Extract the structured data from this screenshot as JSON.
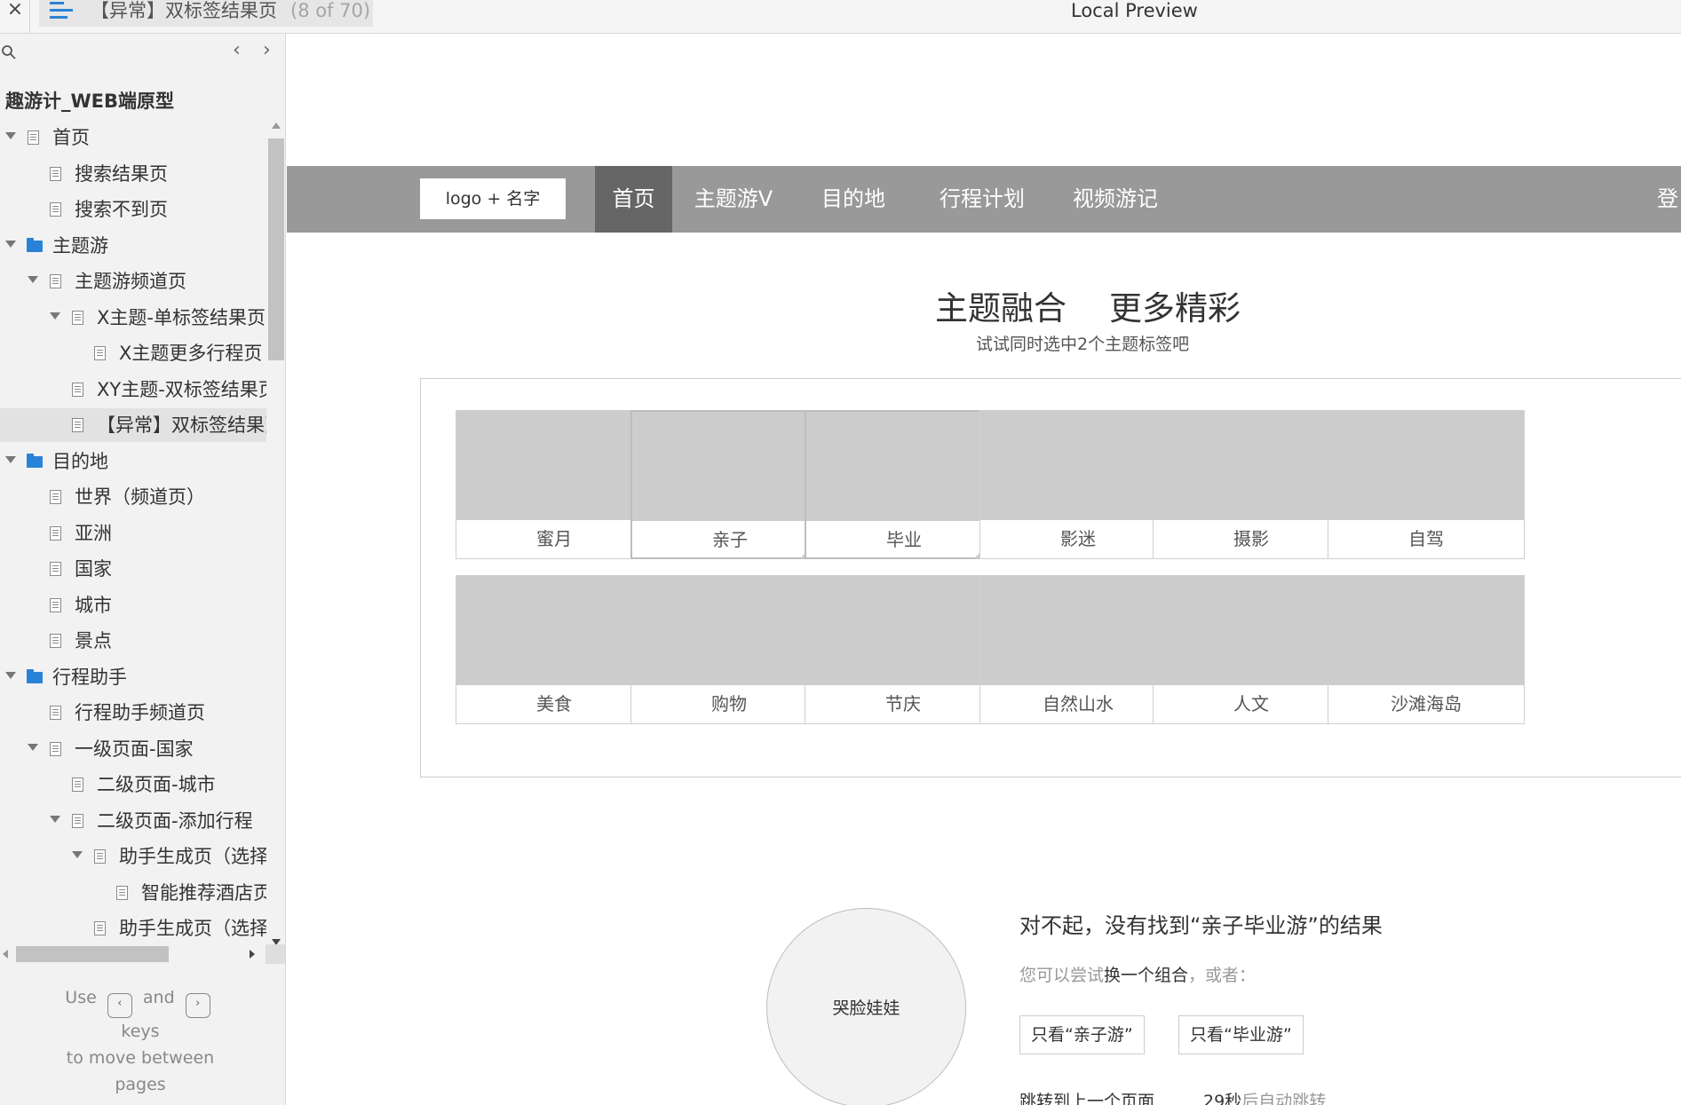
{
  "topbar": {
    "close_glyph": "×",
    "menu_icon": "hamburger-menu-icon",
    "tab_title": "【异常】双标签结果页",
    "tab_count": "(8 of 70)",
    "preview_title": "Local Preview"
  },
  "sidebar": {
    "search_icon": "search-icon",
    "prev_glyph": "‹",
    "next_glyph": "›",
    "project_name": "趣游计_WEB端原型",
    "tree": [
      {
        "label": "首页",
        "type": "page",
        "level": 0,
        "toggle": true
      },
      {
        "label": "搜索结果页",
        "type": "page",
        "level": 1,
        "toggle": false
      },
      {
        "label": "搜索不到页",
        "type": "page",
        "level": 1,
        "toggle": false
      },
      {
        "label": "主题游",
        "type": "folder",
        "level": 0,
        "toggle": true
      },
      {
        "label": "主题游频道页",
        "type": "page",
        "level": 1,
        "toggle": true
      },
      {
        "label": "X主题-单标签结果页",
        "type": "page",
        "level": 2,
        "toggle": true
      },
      {
        "label": "X主题更多行程页",
        "type": "page",
        "level": 3,
        "toggle": false
      },
      {
        "label": "XY主题-双标签结果页",
        "type": "page",
        "level": 2,
        "toggle": false
      },
      {
        "label": "【异常】双标签结果页",
        "type": "page",
        "level": 2,
        "toggle": false,
        "selected": true
      },
      {
        "label": "目的地",
        "type": "folder",
        "level": 0,
        "toggle": true
      },
      {
        "label": "世界（频道页）",
        "type": "page",
        "level": 1,
        "toggle": false
      },
      {
        "label": "亚洲",
        "type": "page",
        "level": 1,
        "toggle": false
      },
      {
        "label": "国家",
        "type": "page",
        "level": 1,
        "toggle": false
      },
      {
        "label": "城市",
        "type": "page",
        "level": 1,
        "toggle": false
      },
      {
        "label": "景点",
        "type": "page",
        "level": 1,
        "toggle": false
      },
      {
        "label": "行程助手",
        "type": "folder",
        "level": 0,
        "toggle": true
      },
      {
        "label": "行程助手频道页",
        "type": "page",
        "level": 1,
        "toggle": false
      },
      {
        "label": "一级页面-国家",
        "type": "page",
        "level": 1,
        "toggle": true
      },
      {
        "label": "二级页面-城市",
        "type": "page",
        "level": 2,
        "toggle": false
      },
      {
        "label": "二级页面-添加行程",
        "type": "page",
        "level": 2,
        "toggle": true
      },
      {
        "label": "助手生成页（选择",
        "type": "page",
        "level": 3,
        "toggle": true
      },
      {
        "label": "智能推荐酒店页",
        "type": "page",
        "level": 4,
        "toggle": false
      },
      {
        "label": "助手生成页（选择",
        "type": "page",
        "level": 3,
        "toggle": false
      }
    ],
    "hint": {
      "use": "Use",
      "key_prev": "‹",
      "and": "and",
      "key_next": "›",
      "keys": "keys",
      "to_move": "to move between",
      "pages": "pages"
    }
  },
  "nav": {
    "logo": "logo + 名字",
    "items": [
      "首页",
      "主题游V",
      "目的地",
      "行程计划",
      "视频游记",
      "登"
    ]
  },
  "hero": {
    "title_left": "主题融合",
    "title_right": "更多精彩",
    "subtitle": "试试同时选中2个主题标签吧"
  },
  "tags": {
    "row1": [
      {
        "label": "蜜月",
        "checked": false
      },
      {
        "label": "亲子",
        "checked": true
      },
      {
        "label": "毕业",
        "checked": true
      },
      {
        "label": "影迷",
        "checked": false
      },
      {
        "label": "摄影",
        "checked": false
      },
      {
        "label": "自驾",
        "checked": false
      }
    ],
    "row2": [
      {
        "label": "美食",
        "checked": false
      },
      {
        "label": "购物",
        "checked": false
      },
      {
        "label": "节庆",
        "checked": false
      },
      {
        "label": "自然山水",
        "checked": false
      },
      {
        "label": "人文",
        "checked": false
      },
      {
        "label": "沙滩海岛",
        "checked": false
      }
    ]
  },
  "result": {
    "image_label": "哭脸娃娃",
    "title": "对不起，没有找到“亲子毕业游”的结果",
    "sub_prefix": "您可以尝试",
    "sub_link": "换一个组合",
    "sub_suffix": "，或者：",
    "btn_a": "只看“亲子游”",
    "btn_b": "只看“毕业游”",
    "foot_jump": "跳转到上一个页面",
    "foot_count": "29秒",
    "foot_auto": "后自动跳转"
  },
  "colors": {
    "nav_bg": "#999999",
    "nav_active": "#666666",
    "accent_blue": "#2a82d6",
    "placeholder_gray": "#cccccc"
  }
}
